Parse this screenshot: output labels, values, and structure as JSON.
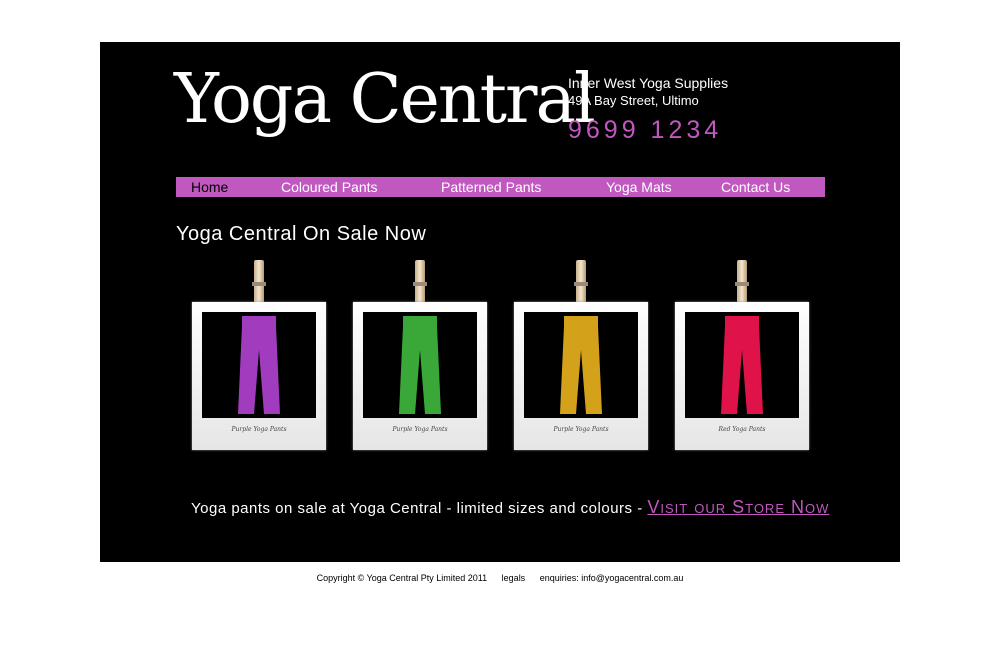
{
  "header": {
    "logo_text": "Yoga Central",
    "tagline": "Inner West Yoga Supplies",
    "address": "49A Bay Street, Ultimo",
    "phone": "9699 1234"
  },
  "colors": {
    "accent": "#c058c0",
    "background": "#000000",
    "page": "#ffffff"
  },
  "nav": {
    "items": [
      {
        "label": "Home",
        "active": true
      },
      {
        "label": "Coloured Pants"
      },
      {
        "label": "Patterned Pants"
      },
      {
        "label": "Yoga Mats"
      },
      {
        "label": "Contact Us"
      }
    ]
  },
  "main": {
    "heading": "Yoga Central On Sale Now",
    "products": [
      {
        "caption": "Purple Yoga Pants",
        "color": "#a23cbf"
      },
      {
        "caption": "Purple Yoga Pants",
        "color": "#3aa838"
      },
      {
        "caption": "Purple Yoga Pants",
        "color": "#d4a11a"
      },
      {
        "caption": "Red Yoga Pants",
        "color": "#e0124a"
      }
    ],
    "promo_text": "Yoga pants on sale at Yoga Central - limited sizes and colours -",
    "promo_link": "Visit our Store Now"
  },
  "footer": {
    "copyright": "Copyright © Yoga Central Pty Limited 2011",
    "legals": "legals",
    "enquiries": "enquiries:  info@yogacentral.com.au"
  }
}
